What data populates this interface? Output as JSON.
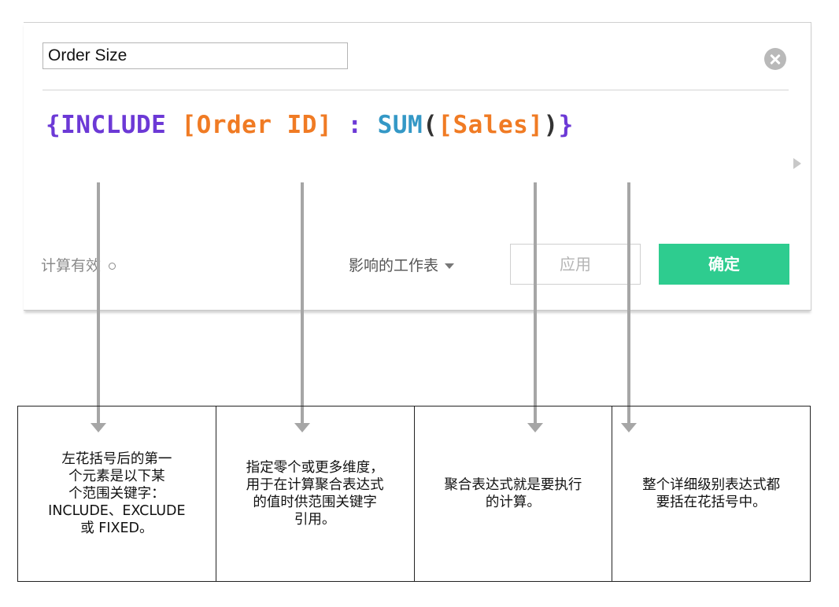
{
  "dialog": {
    "calc_name": "Order Size",
    "formula": {
      "open_brace": "{",
      "keyword": "INCLUDE",
      "dimension": "[Order ID]",
      "colon": ":",
      "function": "SUM",
      "paren_open": "(",
      "measure": "[Sales]",
      "paren_close": ")",
      "close_brace": "}"
    },
    "status_text": "计算有效",
    "sheets_dropdown_label": "影响的工作表",
    "apply_label": "应用",
    "ok_label": "确定"
  },
  "callouts": [
    {
      "text": "左花括号后的第一\n个元素是以下某\n个范围关键字：\nINCLUDE、EXCLUDE\n或 FIXED。"
    },
    {
      "text": "指定零个或更多维度，\n用于在计算聚合表达式\n的值时供范围关键字\n引用。"
    },
    {
      "text": "聚合表达式就是要执行\n的计算。"
    },
    {
      "text": "整个详细级别表达式都\n要括在花括号中。"
    }
  ],
  "colors": {
    "keyword": "#6c39d6",
    "field": "#f07b24",
    "function": "#3498c6",
    "ok_button": "#2ecc8f",
    "pointer": "#a6a6a6"
  }
}
